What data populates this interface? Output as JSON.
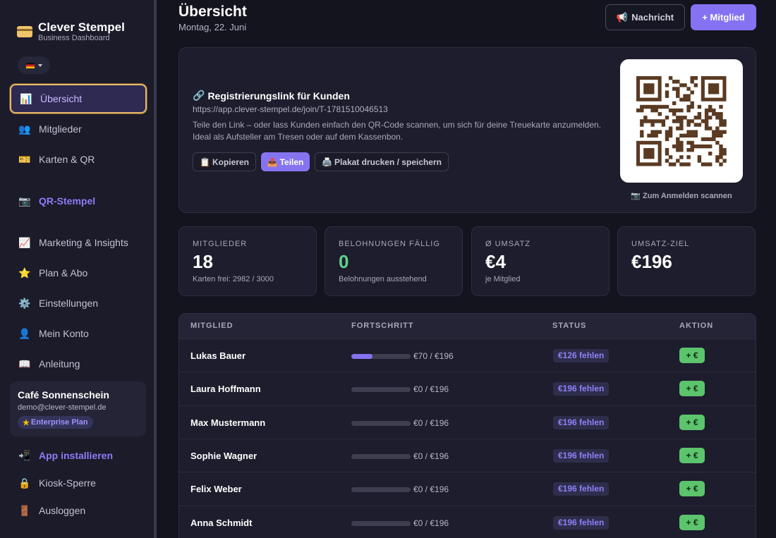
{
  "brand": {
    "title": "Clever Stempel",
    "subtitle": "Business Dashboard",
    "icon": "credit-card-icon"
  },
  "language": {
    "flag": "de-flag-icon"
  },
  "sidebar": {
    "items": [
      {
        "label": "Übersicht",
        "icon": "chart-icon",
        "glyph": "📊",
        "active": true
      },
      {
        "label": "Mitglieder",
        "icon": "users-icon",
        "glyph": "👥"
      },
      {
        "label": "Karten & QR",
        "icon": "card-icon",
        "glyph": "🎫"
      },
      {
        "label": "QR-Stempel",
        "icon": "camera-icon",
        "glyph": "📷",
        "accent": true
      },
      {
        "label": "Marketing & Insights",
        "icon": "trend-chart-icon",
        "glyph": "📈"
      },
      {
        "label": "Plan & Abo",
        "icon": "star-icon",
        "glyph": "⭐"
      },
      {
        "label": "Einstellungen",
        "icon": "gear-icon",
        "glyph": "⚙️"
      },
      {
        "label": "Mein Konto",
        "icon": "user-icon",
        "glyph": "👤"
      },
      {
        "label": "Anleitung",
        "icon": "book-icon",
        "glyph": "📖"
      }
    ],
    "account": {
      "name": "Café Sonnenschein",
      "email": "demo@clever-stempel.de",
      "plan": "Enterprise Plan"
    },
    "bottom_items": [
      {
        "label": "App installieren",
        "icon": "phone-install-icon",
        "glyph": "📲",
        "accent": true
      },
      {
        "label": "Kiosk-Sperre",
        "icon": "lock-icon",
        "glyph": "🔒"
      },
      {
        "label": "Ausloggen",
        "icon": "door-icon",
        "glyph": "🚪"
      }
    ]
  },
  "header": {
    "title": "Übersicht",
    "date": "Montag, 22. Juni",
    "message_button": "Nachricht",
    "add_member_button": "+ Mitglied"
  },
  "registration": {
    "title": "Registrierungslink für Kunden",
    "link": "https://app.clever-stempel.de/join/T-1781510046513",
    "description": "Teile den Link – oder lass Kunden einfach den QR-Code scannen, um sich für deine Treuekarte anzumelden. Ideal als Aufsteller am Tresen oder auf dem Kassenbon.",
    "copy_button": "Kopieren",
    "share_button": "Teilen",
    "print_button": "Plakat drucken / speichern",
    "qr_caption": "Zum Anmelden scannen"
  },
  "stats": [
    {
      "label": "MITGLIEDER",
      "value": "18",
      "sub": "Karten frei: 2982 / 3000",
      "highlight": false
    },
    {
      "label": "BELOHNUNGEN FÄLLIG",
      "value": "0",
      "sub": "Belohnungen ausstehend",
      "highlight": true
    },
    {
      "label": "Ø UMSATZ",
      "value": "€4",
      "sub": "je Mitglied",
      "highlight": false
    },
    {
      "label": "UMSATZ-ZIEL",
      "value": "€196",
      "sub": "",
      "highlight": false
    }
  ],
  "table": {
    "headers": [
      "MITGLIED",
      "FORTSCHRITT",
      "STATUS",
      "AKTION"
    ],
    "action_label": "+ €",
    "rows": [
      {
        "name": "Lukas Bauer",
        "progress": "€70 / €196",
        "fraction": 0.357,
        "status": "€126 fehlen"
      },
      {
        "name": "Laura Hoffmann",
        "progress": "€0 / €196",
        "fraction": 0,
        "status": "€196 fehlen"
      },
      {
        "name": "Max Mustermann",
        "progress": "€0 / €196",
        "fraction": 0,
        "status": "€196 fehlen"
      },
      {
        "name": "Sophie Wagner",
        "progress": "€0 / €196",
        "fraction": 0,
        "status": "€196 fehlen"
      },
      {
        "name": "Felix Weber",
        "progress": "€0 / €196",
        "fraction": 0,
        "status": "€196 fehlen"
      },
      {
        "name": "Anna Schmidt",
        "progress": "€0 / €196",
        "fraction": 0,
        "status": "€196 fehlen"
      }
    ]
  }
}
